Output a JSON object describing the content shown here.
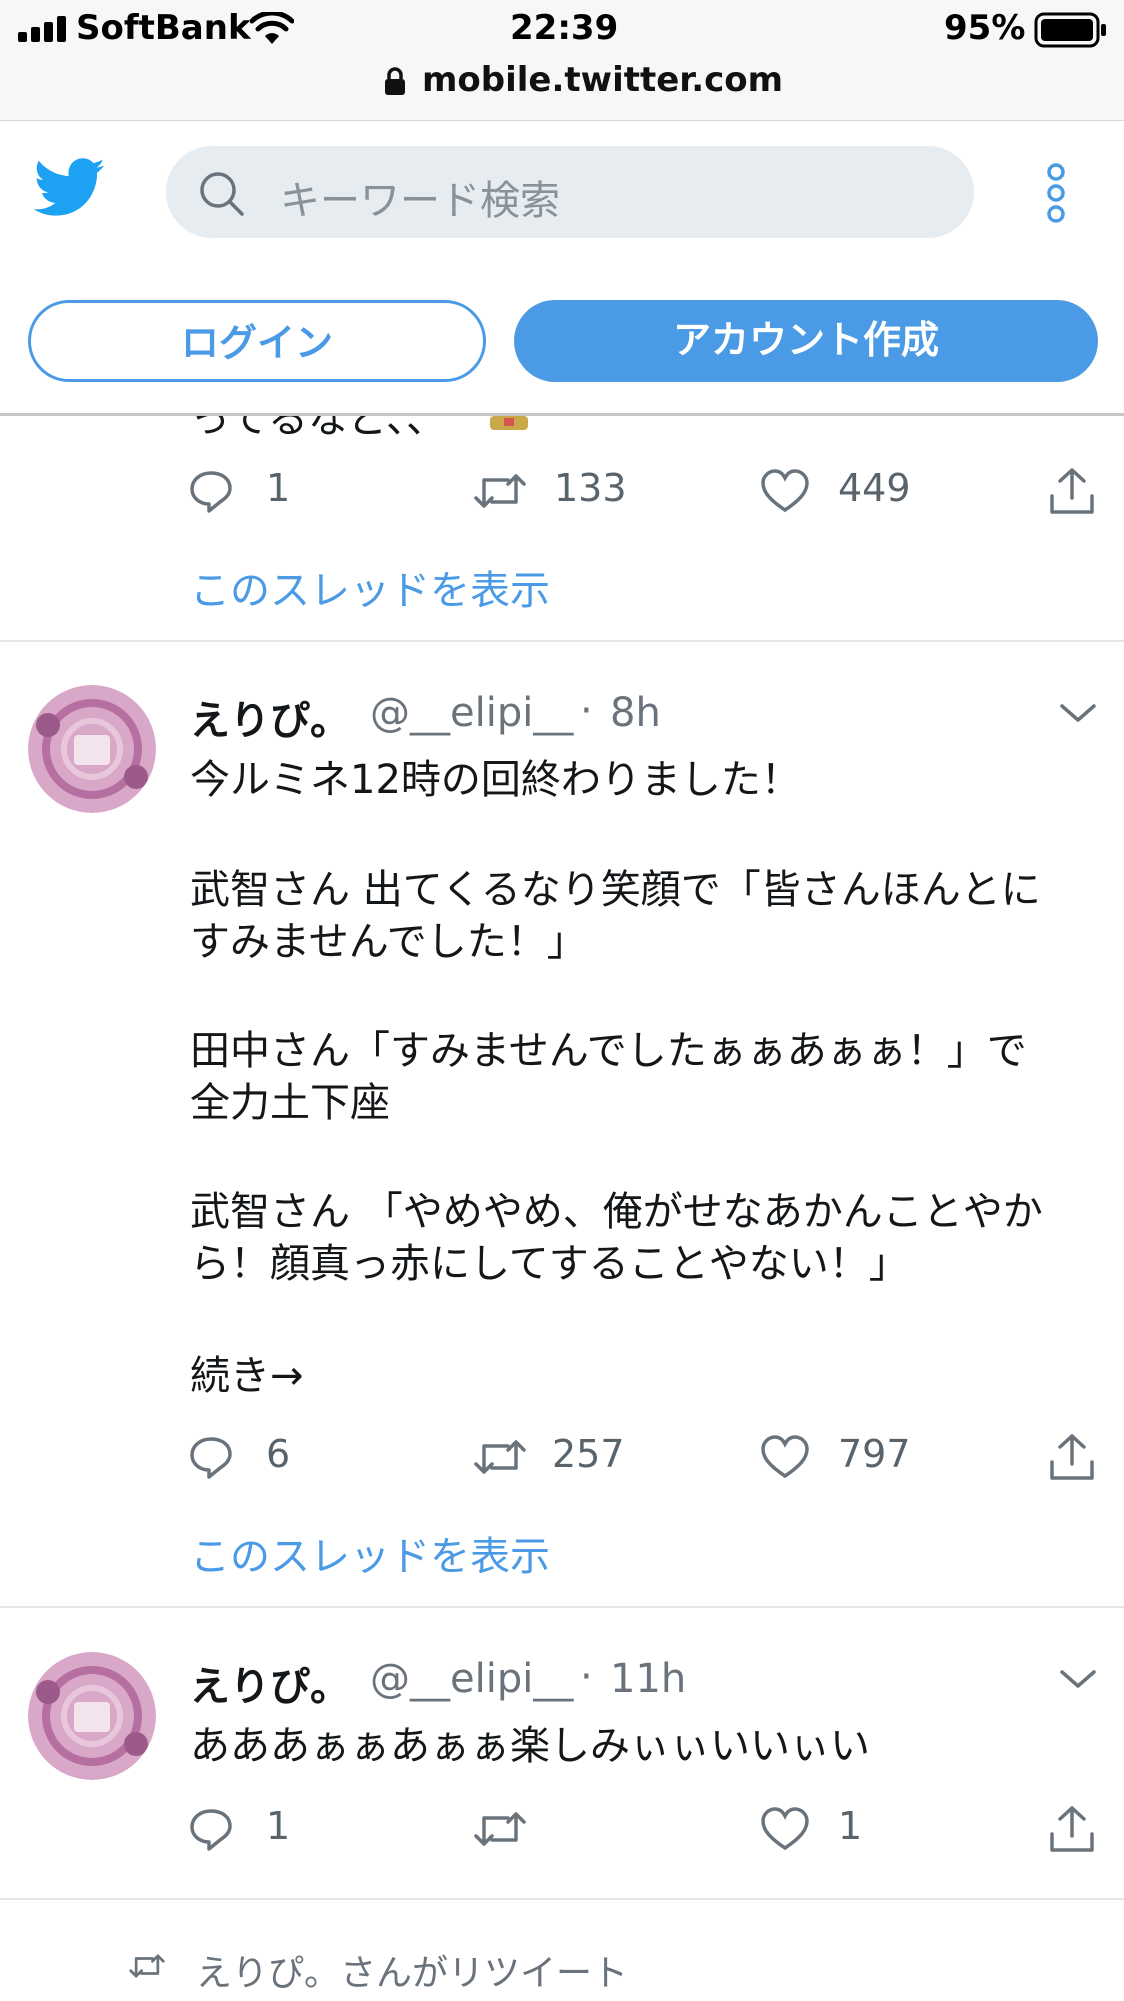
{
  "status_bar": {
    "carrier": "SoftBank",
    "time": "22:39",
    "battery": "95%",
    "url": "mobile.twitter.com"
  },
  "header": {
    "search_placeholder": "キーワード検索",
    "login_label": "ログイン",
    "signup_label": "アカウント作成"
  },
  "partial_tweet": {
    "text_fragment": "ってるなど、、",
    "replies": "1",
    "retweets": "133",
    "likes": "449",
    "thread_link": "このスレッドを表示"
  },
  "tweets": [
    {
      "name": "えりぴ。",
      "handle": "@__elipi__",
      "dot": "·",
      "time": "8h",
      "lines": [
        "今ルミネ12時の回終わりました！",
        "",
        "武智さん 出てくるなり笑顔で「皆さんほんとに",
        "すみませんでした！」",
        "",
        "田中さん「すみませんでしたぁぁあぁぁ！」で",
        "全力土下座",
        "",
        "武智さん 「やめやめ、俺がせなあかんことやか",
        "ら！顔真っ赤にしてすることやない！」",
        "",
        "続き→"
      ],
      "replies": "6",
      "retweets": "257",
      "likes": "797",
      "thread_link": "このスレッドを表示"
    },
    {
      "name": "えりぴ。",
      "handle": "@__elipi__",
      "dot": "·",
      "time": "11h",
      "lines": [
        "あああぁぁあぁぁ楽しみぃぃいいぃい"
      ],
      "replies": "1",
      "retweets": "",
      "likes": "1"
    }
  ],
  "retweet_notice": "えりぴ。さんがリツイート",
  "colors": {
    "accent": "#4a9ae6",
    "twitter_blue": "#1da1f2",
    "text": "#14171a",
    "secondary": "#6a737c"
  }
}
